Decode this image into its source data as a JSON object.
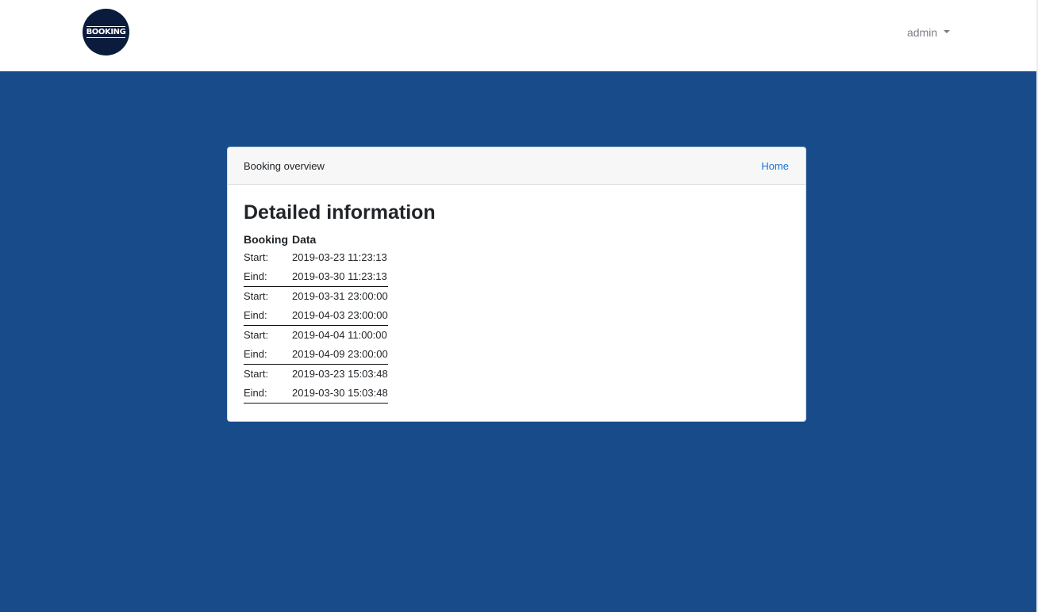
{
  "navbar": {
    "logo_text": "BOOKING",
    "user_menu_label": "admin"
  },
  "card": {
    "header_title": "Booking overview",
    "home_link": "Home",
    "title": "Detailed information",
    "table": {
      "headers": [
        "Booking",
        "Data"
      ],
      "rows": [
        {
          "label": "Start:",
          "value": "2019-03-23 11:23:13"
        },
        {
          "label": "Eind:",
          "value": "2019-03-30 11:23:13"
        },
        {
          "label": "Start:",
          "value": "2019-03-31 23:00:00"
        },
        {
          "label": "Eind:",
          "value": "2019-04-03 23:00:00"
        },
        {
          "label": "Start:",
          "value": "2019-04-04 11:00:00"
        },
        {
          "label": "Eind:",
          "value": "2019-04-09 23:00:00"
        },
        {
          "label": "Start:",
          "value": "2019-03-23 15:03:48"
        },
        {
          "label": "Eind:",
          "value": "2019-03-30 15:03:48"
        }
      ]
    }
  },
  "colors": {
    "background": "#184b8a",
    "link": "#1a74d4",
    "logo_bg": "#0b1b3c"
  }
}
